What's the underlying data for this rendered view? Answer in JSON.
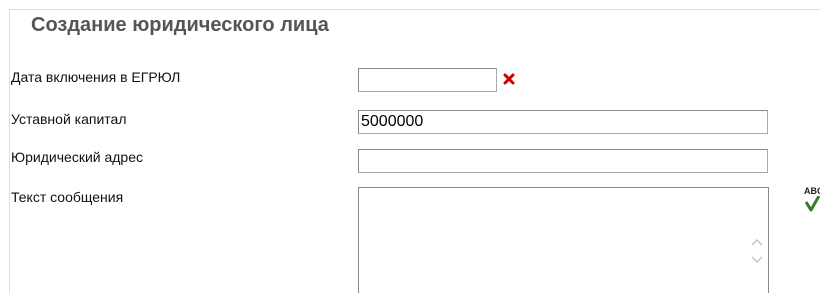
{
  "form": {
    "title": "Создание юридического лица",
    "fields": [
      {
        "label": "Дата включения в ЕГРЮЛ",
        "value": "",
        "placeholder": ""
      },
      {
        "label": "Уставной капитал",
        "value": "5000000",
        "placeholder": ""
      },
      {
        "label": "Юридический адрес",
        "value": "",
        "placeholder": ""
      },
      {
        "label": "Текст сообщения",
        "value": "",
        "placeholder": ""
      }
    ]
  },
  "icons": {
    "clear": "close-icon",
    "spellcheck": "spellcheck-icon",
    "scroll_up": "chevron-up-icon",
    "scroll_down": "chevron-down-icon"
  },
  "spellcheck": {
    "text": "ABC"
  },
  "colors": {
    "title": "#555555",
    "clear_icon": "#cc0000",
    "frame_border": "#dedede",
    "input_border": "#8a8a8a",
    "spell_check_mark": "#3a7a2a"
  }
}
